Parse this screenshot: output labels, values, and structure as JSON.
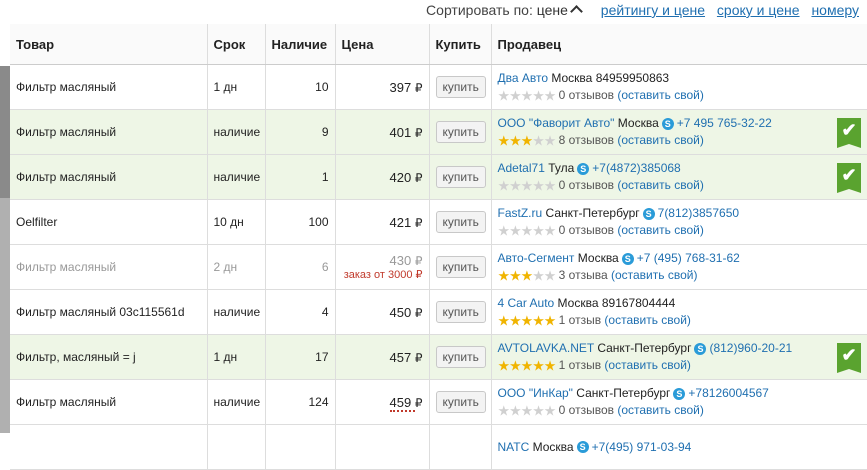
{
  "sort": {
    "label": "Сортировать по:",
    "current": "цене",
    "options": [
      "рейтингу и цене",
      "сроку и цене",
      "номеру"
    ]
  },
  "columns": {
    "name": "Товар",
    "term": "Срок",
    "qty": "Наличие",
    "price": "Цена",
    "buy": "Купить",
    "seller": "Продавец"
  },
  "currency": "₽",
  "buy_label": "купить",
  "leave_label": "(оставить свой)",
  "rows": [
    {
      "name": "Фильтр масляный",
      "term": "1 дн",
      "qty": "10",
      "price": "397",
      "min_order": "",
      "hl": false,
      "dim": false,
      "wavy": false,
      "seller": {
        "name": "Два Авто",
        "city": "Москва",
        "phone": "84959950863",
        "skype": false,
        "stars": 0,
        "reviews": "0 отзывов",
        "check": false
      }
    },
    {
      "name": "Фильтр масляный",
      "term": "наличие",
      "qty": "9",
      "price": "401",
      "min_order": "",
      "hl": true,
      "dim": false,
      "wavy": false,
      "seller": {
        "name": "ООО \"Фаворит Авто\"",
        "city": "Москва",
        "phone": "+7 495 765-32-22",
        "skype": true,
        "stars": 3,
        "reviews": "8 отзывов",
        "check": true
      }
    },
    {
      "name": "Фильтр масляный",
      "term": "наличие",
      "qty": "1",
      "price": "420",
      "min_order": "",
      "hl": true,
      "dim": false,
      "wavy": false,
      "seller": {
        "name": "Adetal71",
        "city": "Тула",
        "phone": "+7(4872)385068",
        "skype": true,
        "stars": 0,
        "reviews": "0 отзывов",
        "check": true
      }
    },
    {
      "name": "Oelfilter",
      "term": "10 дн",
      "qty": "100",
      "price": "421",
      "min_order": "",
      "hl": false,
      "dim": false,
      "wavy": false,
      "seller": {
        "name": "FastZ.ru",
        "city": "Санкт-Петербург",
        "phone": "7(812)3857650",
        "skype": true,
        "stars": 0,
        "reviews": "0 отзывов",
        "check": false
      }
    },
    {
      "name": "Фильтр масляный",
      "term": "2 дн",
      "qty": "6",
      "price": "430",
      "min_order": "заказ от 3000 ₽",
      "hl": false,
      "dim": true,
      "wavy": false,
      "seller": {
        "name": "Авто-Сегмент",
        "city": "Москва",
        "phone": "+7 (495) 768-31-62",
        "skype": true,
        "stars": 3,
        "reviews": "3 отзыва",
        "check": false
      }
    },
    {
      "name": "Фильтр масляный 03c115561d",
      "term": "наличие",
      "qty": "4",
      "price": "450",
      "min_order": "",
      "hl": false,
      "dim": false,
      "wavy": false,
      "seller": {
        "name": "4 Car Auto",
        "city": "Москва",
        "phone": "89167804444",
        "skype": false,
        "stars": 5,
        "reviews": "1 отзыв",
        "check": false
      }
    },
    {
      "name": "Фильтр, масляный = j",
      "term": "1 дн",
      "qty": "17",
      "price": "457",
      "min_order": "",
      "hl": true,
      "dim": false,
      "wavy": false,
      "seller": {
        "name": "AVTOLAVKA.NET",
        "city": "Санкт-Петербург",
        "phone": "(812)960-20-21",
        "skype": true,
        "stars": 5,
        "reviews": "1 отзыв",
        "check": true
      }
    },
    {
      "name": "Фильтр масляный",
      "term": "наличие",
      "qty": "124",
      "price": "459",
      "min_order": "",
      "hl": false,
      "dim": false,
      "wavy": true,
      "seller": {
        "name": "ООО \"ИнКар\"",
        "city": "Санкт-Петербург",
        "phone": "+78126004567",
        "skype": true,
        "stars": 0,
        "reviews": "0 отзывов",
        "check": false
      }
    },
    {
      "name": "",
      "term": "",
      "qty": "",
      "price": "",
      "min_order": "",
      "hl": false,
      "dim": false,
      "wavy": false,
      "seller": {
        "name": "NATC",
        "city": "Москва",
        "phone": "+7(495) 971-03-94",
        "skype": true,
        "stars": 0,
        "reviews": "",
        "check": false
      }
    }
  ]
}
